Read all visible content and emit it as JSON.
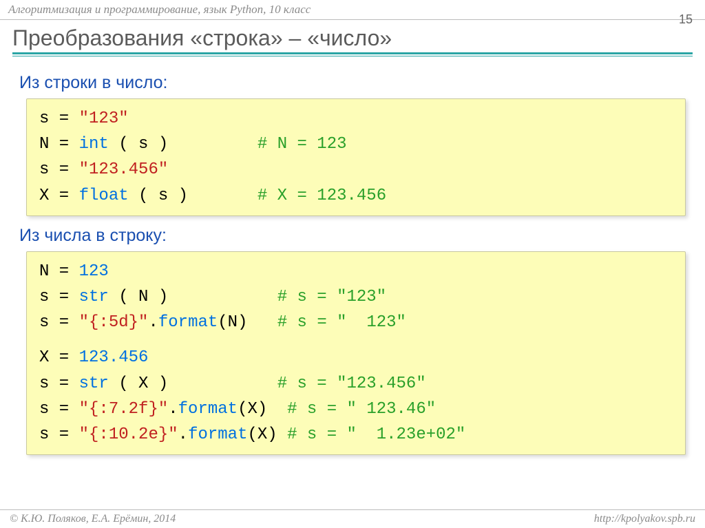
{
  "header": "Алгоритмизация и программирование, язык Python, 10 класс",
  "page_number": "15",
  "title": "Преобразования «строка» – «число»",
  "section1": {
    "heading": "Из строки в число:",
    "code": {
      "l1_a": "s",
      "l1_b": "\"123\"",
      "l2_a": "N",
      "l2_b": "int",
      "l2_c": " ( s )         ",
      "l2_d": "# N = 123",
      "l3_a": "s",
      "l3_b": "\"123.456\"",
      "l4_a": "X",
      "l4_b": "float",
      "l4_c": " ( s )       ",
      "l4_d": "# X = 123.456"
    }
  },
  "section2": {
    "heading": "Из числа в строку:",
    "code": {
      "l1_a": "N",
      "l1_b": "123",
      "l2_a": "s",
      "l2_b": "str",
      "l2_c": " ( N )           ",
      "l2_d": "# s = \"123\"",
      "l3_a": "s",
      "l3_b": "\"{:5d}\"",
      "l3_c": ".",
      "l3_d": "format",
      "l3_e": "(N)   ",
      "l3_f": "# s = \"  123\"",
      "l4_a": "X",
      "l4_b": "123.456",
      "l5_a": "s",
      "l5_b": "str",
      "l5_c": " ( X )           ",
      "l5_d": "# s = \"123.456\"",
      "l6_a": "s",
      "l6_b": "\"{:7.2f}\"",
      "l6_c": ".",
      "l6_d": "format",
      "l6_e": "(X)  ",
      "l6_f": "# s = \" 123.46\"",
      "l7_a": "s",
      "l7_b": "\"{:10.2e}\"",
      "l7_c": ".",
      "l7_d": "format",
      "l7_e": "(X) ",
      "l7_f": "# s = \"  1.23e+02\""
    }
  },
  "footer": {
    "left": "© К.Ю. Поляков, Е.А. Ерёмин, 2014",
    "right": "http://kpolyakov.spb.ru"
  }
}
